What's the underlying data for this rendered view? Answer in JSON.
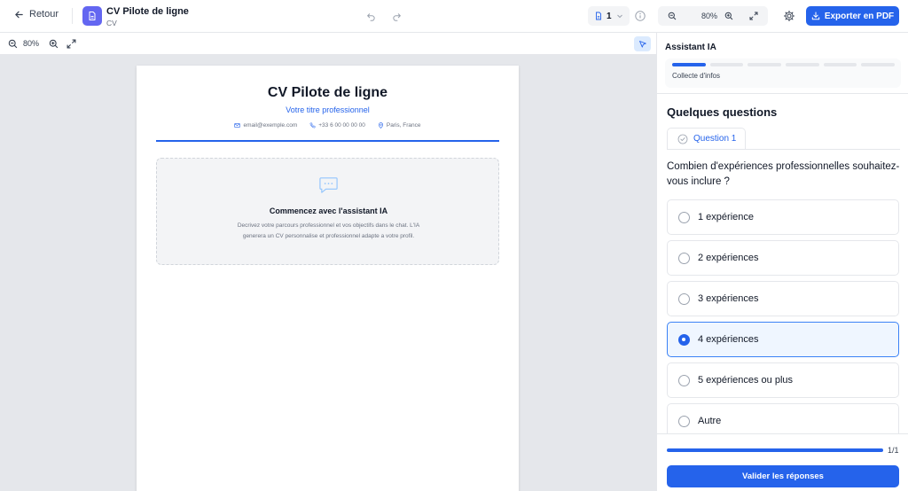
{
  "header": {
    "back_label": "Retour",
    "doc_title": "CV Pilote de ligne",
    "doc_subtitle": "CV",
    "page_number": "1",
    "zoom": "80%",
    "export_label": "Exporter en PDF",
    "accent_color": "#2563eb",
    "badge_color": "#6366f1"
  },
  "editor_toolbar": {
    "zoom": "80%"
  },
  "cv": {
    "name": "CV Pilote de ligne",
    "title": "Votre titre professionnel",
    "email": "email@exemple.com",
    "phone": "+33 6 00 00 00 00",
    "location": "Paris, France",
    "empty_title": "Commencez avec l'assistant IA",
    "empty_description": "Decrivez votre parcours professionnel et vos objectifs dans le chat. L'IA generera un CV personnalise et professionnel adapte a votre profil."
  },
  "assistant": {
    "title": "Assistant IA",
    "step_label": "Collecte d'infos",
    "step_segments": [
      true,
      false,
      false,
      false,
      false,
      false
    ],
    "section_title": "Quelques questions",
    "question_tab": "Question 1",
    "question_text": "Combien d'expériences professionnelles souhaitez-vous inclure ?",
    "options": [
      {
        "label": "1 expérience",
        "selected": false
      },
      {
        "label": "2 expériences",
        "selected": false
      },
      {
        "label": "3 expériences",
        "selected": false
      },
      {
        "label": "4 expériences",
        "selected": true
      },
      {
        "label": "5 expériences ou plus",
        "selected": false
      },
      {
        "label": "Autre",
        "selected": false
      }
    ],
    "progress_count": "1/1",
    "progress_fraction": 1.0,
    "validate_label": "Valider les réponses"
  }
}
